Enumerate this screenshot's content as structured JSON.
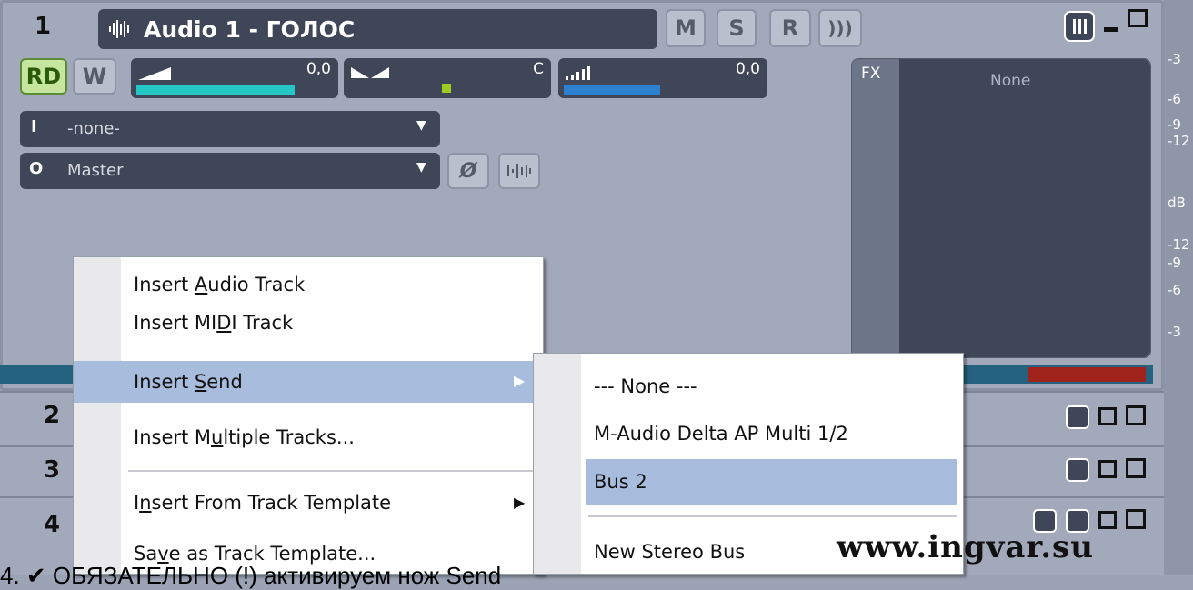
{
  "track1": {
    "number": "1",
    "name": "Audio 1 - ГОЛОС",
    "buttons": {
      "m": "M",
      "s": "S",
      "r": "R",
      "fx_power": ")))"
    },
    "rd": "RD",
    "w": "W",
    "volume_value": "0,0",
    "pan_value": "C",
    "width_value": "0,0",
    "input": {
      "prefix": "I",
      "value": "-none-"
    },
    "output": {
      "prefix": "O",
      "value": "Master"
    },
    "fx_label": "FX",
    "fx_chain_value": "None"
  },
  "tracks": [
    {
      "number": "2"
    },
    {
      "number": "3"
    },
    {
      "number": "4"
    }
  ],
  "meter_scale": [
    "-3",
    "-6",
    "-9",
    "-12",
    "dB",
    "-12",
    "-9",
    "-6",
    "-3"
  ],
  "context_menu": {
    "items": [
      {
        "pre": "Insert ",
        "u": "A",
        "post": "udio Track",
        "submenu": false
      },
      {
        "pre": "Insert MI",
        "u": "D",
        "post": "I Track",
        "submenu": false
      },
      {
        "pre": "Insert ",
        "u": "S",
        "post": "end",
        "submenu": true
      },
      {
        "pre": "Insert M",
        "u": "u",
        "post": "ltiple Tracks...",
        "submenu": false
      },
      {
        "pre": "I",
        "u": "n",
        "post": "sert From Track Template",
        "submenu": true
      },
      {
        "pre": "Sa",
        "u": "v",
        "post": "e as Track Template...",
        "submenu": false
      }
    ]
  },
  "send_submenu": {
    "items": [
      "--- None ---",
      "M-Audio Delta AP Multi 1/2",
      "Bus 2",
      "New Stereo Bus"
    ],
    "selected": "Bus 2"
  },
  "watermark": "www.ingvar.su",
  "caption": "4. ✔ ОБЯЗАТЕЛЬНО (!) активируем нож Send",
  "colors": {
    "menu_highlight": "#a8bcde",
    "volume_bar": "#25c6c6",
    "width_bar": "#2d7fd0",
    "pan_marker": "#9ccc22",
    "meter_red": "#a0241c"
  }
}
